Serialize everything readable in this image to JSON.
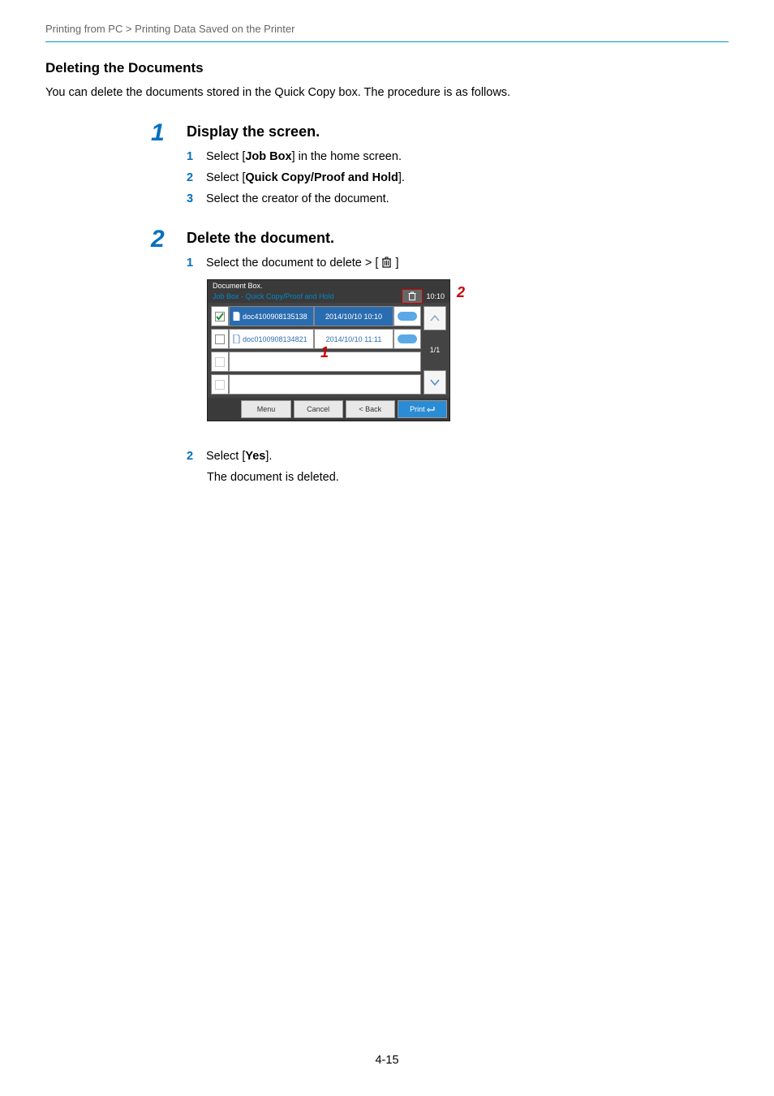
{
  "breadcrumb": "Printing from PC > Printing Data Saved on the Printer",
  "section_title": "Deleting the Documents",
  "intro": "You can delete the documents stored in the Quick Copy box. The procedure is as follows.",
  "step1": {
    "num": "1",
    "title": "Display the screen.",
    "items": [
      {
        "n": "1",
        "pre": "Select [",
        "bold": "Job Box",
        "post": "] in the home screen."
      },
      {
        "n": "2",
        "pre": "Select [",
        "bold": "Quick Copy/Proof and Hold",
        "post": "]."
      },
      {
        "n": "3",
        "pre": "Select the creator of the document.",
        "bold": "",
        "post": ""
      }
    ]
  },
  "step2": {
    "num": "2",
    "title": "Delete the document.",
    "sub1_n": "1",
    "sub1_text": "Select the document to delete > [",
    "sub1_after": "]",
    "sub2_n": "2",
    "sub2_pre": "Select [",
    "sub2_bold": "Yes",
    "sub2_post": "].",
    "sub2_note": "The document is deleted."
  },
  "screen": {
    "title1": "Document Box.",
    "title2": "Job Box - Quick Copy/Proof and Hold",
    "clock": "10:10",
    "rows": [
      {
        "name": "doc4100908135138",
        "date": "2014/10/10 10:10",
        "selected": true
      },
      {
        "name": "doc0100908134821",
        "date": "2014/10/10 11:11",
        "selected": false
      }
    ],
    "page_lbl": "1/1",
    "buttons": {
      "menu": "Menu",
      "cancel": "Cancel",
      "back": "< Back",
      "print": "Print"
    },
    "callout1": "1",
    "callout2": "2"
  },
  "icons": {
    "trash": "trash-icon",
    "doc": "document-icon",
    "up": "chevron-up-icon",
    "down": "chevron-down-icon",
    "enter": "enter-icon",
    "check": "check-icon"
  },
  "page_num": "4-15"
}
